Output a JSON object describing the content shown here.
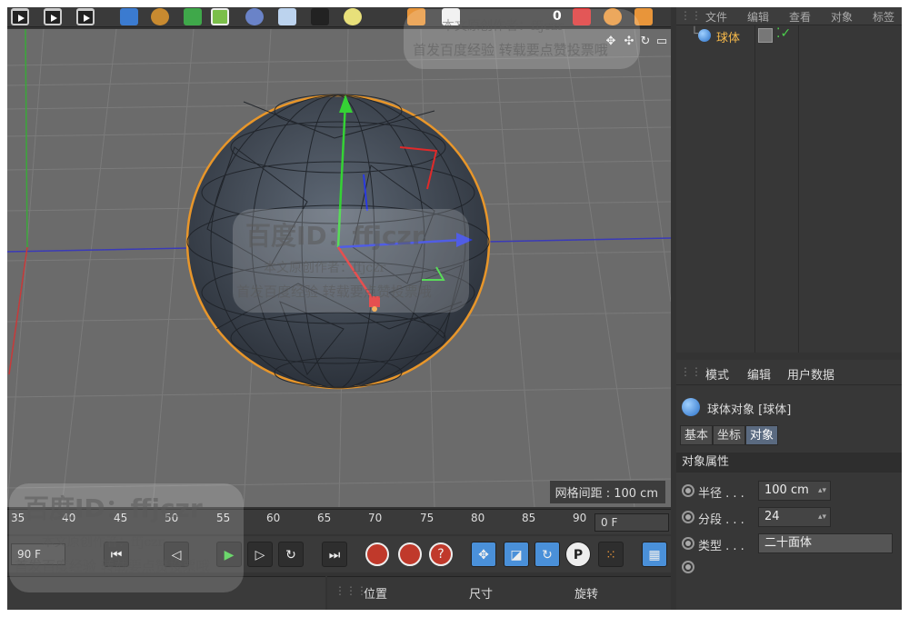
{
  "toolbar": {
    "counter": "0",
    "icons": [
      "film-play-icon",
      "film-play-icon",
      "film-play-icon",
      "cube-icon",
      "bend-icon",
      "cylinder-icon",
      "deformer-icon",
      "camera-icon",
      "light-icon",
      "undo-icon",
      "snap-icon",
      "render-icon",
      "arrow-icon"
    ]
  },
  "viewport": {
    "grid_label": "网格间距 : 100 cm",
    "object": "sphere-mesh"
  },
  "object_manager": {
    "menu": [
      "文件",
      "编辑",
      "查看",
      "对象",
      "标签"
    ],
    "object_name": "球体"
  },
  "attributes": {
    "menu": [
      "模式",
      "编辑",
      "用户数据"
    ],
    "object_title": "球体对象 [球体]",
    "tabs": [
      "基本",
      "坐标",
      "对象"
    ],
    "active_tab": "对象",
    "section_title": "对象属性",
    "props": [
      {
        "label": "半径 . . .",
        "value": "100 cm"
      },
      {
        "label": "分段 . . .",
        "value": "24"
      },
      {
        "label": "类型 . . .",
        "value": "二十面体"
      },
      {
        "label": "",
        "value": ""
      }
    ]
  },
  "timeline": {
    "ticks": [
      "35",
      "40",
      "45",
      "50",
      "55",
      "60",
      "65",
      "70",
      "75",
      "80",
      "85",
      "90"
    ],
    "current_frame": "0 F",
    "end_frame": "90 F"
  },
  "coordinates": {
    "headers": [
      "位置",
      "尺寸",
      "旋转"
    ]
  },
  "watermark": {
    "id_line": "百度ID：ffjczr",
    "author_line": "本文原创作者：ffjczr",
    "slogan_line": "首发百度经验  转载要点赞投票哦"
  }
}
